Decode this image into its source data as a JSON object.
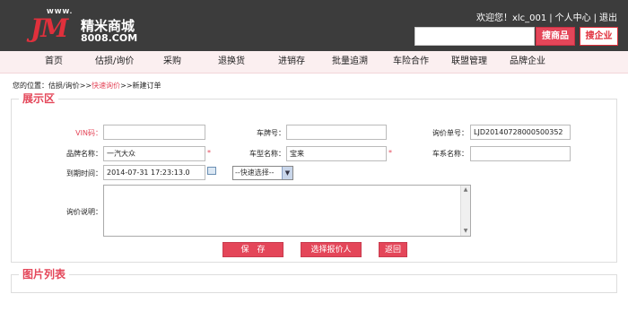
{
  "logo": {
    "www": "WWW.",
    "mark": "JM",
    "name": "精米商城",
    "domain": "8008.COM"
  },
  "header": {
    "welcome": "欢迎您！xlc_001",
    "personal_center": "个人中心",
    "logout": "退出",
    "search_value": "",
    "search_goods": "搜商品",
    "search_company": "搜企业"
  },
  "nav": [
    "首页",
    "估损/询价",
    "采购",
    "退换货",
    "进销存",
    "批量追溯",
    "车险合作",
    "联盟管理",
    "品牌企业"
  ],
  "breadcrumb": {
    "prefix": "您的位置：估损/询价>>",
    "current": "快速询价",
    "suffix": ">>新建订单"
  },
  "display_panel": {
    "title": "展示区",
    "vin_label": "VIN码：",
    "vin_value": "",
    "plate_label": "车牌号：",
    "plate_value": "",
    "inquiry_no_label": "询价单号：",
    "inquiry_no_value": "LJD20140728000500352",
    "brand_label": "品牌名称：",
    "brand_value": "一汽大众",
    "model_label": "车型名称：",
    "model_value": "宝来",
    "series_label": "车系名称：",
    "series_value": "",
    "required_mark": "*",
    "deadline_label": "到期时间：",
    "deadline_value": "2014-07-31 17:23:13.0",
    "quick_select": "--快速选择--",
    "desc_label": "询价说明："
  },
  "buttons": {
    "save": "保　存",
    "choose_quoter": "选择报价人",
    "back": "返回"
  },
  "image_panel": {
    "title": "图片列表"
  }
}
